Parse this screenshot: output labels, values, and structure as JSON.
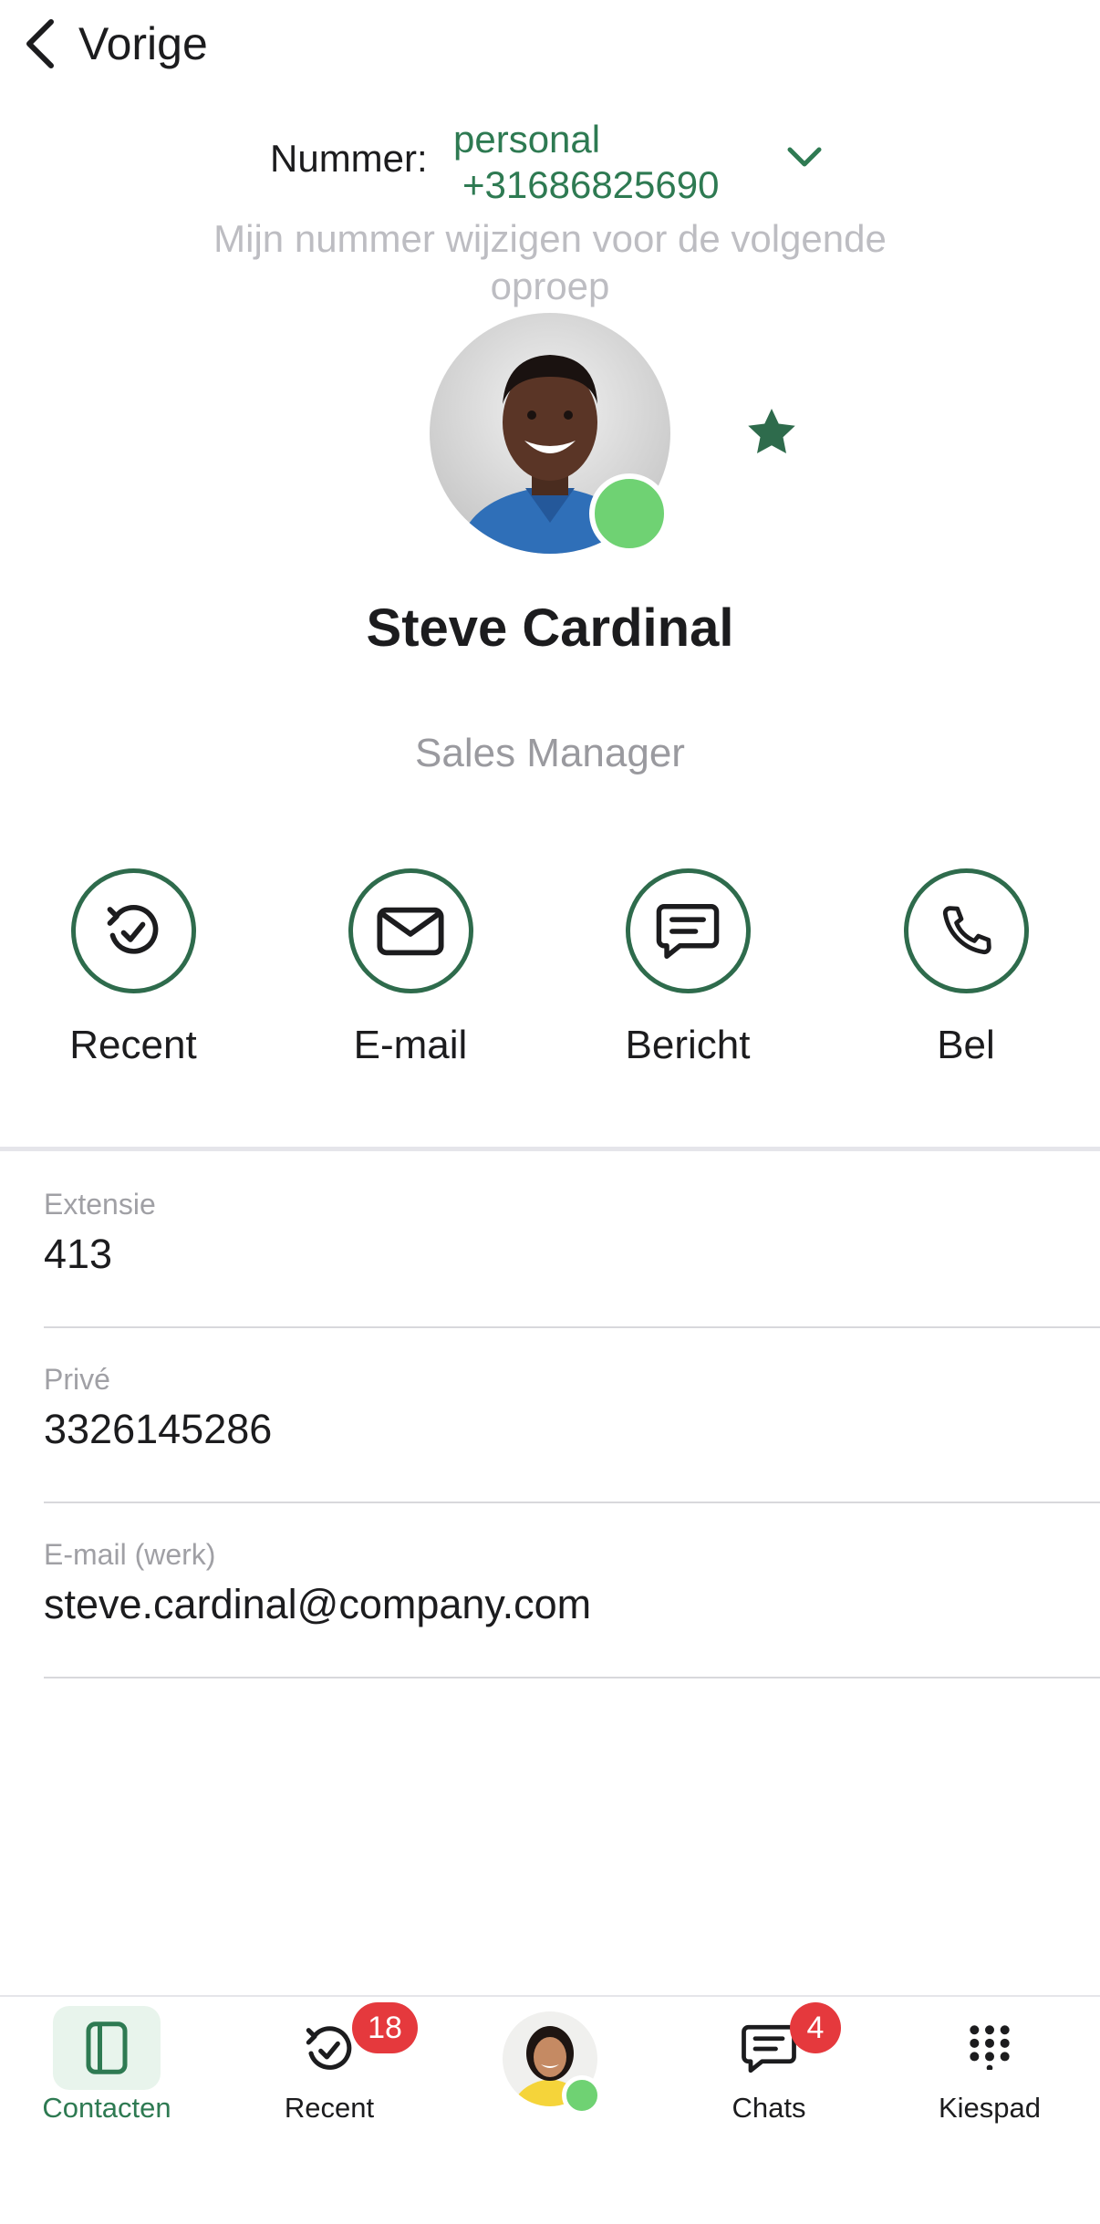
{
  "header": {
    "back_label": "Vorige",
    "back_icon": "chevron-left-icon"
  },
  "number_selector": {
    "label": "Nummer:",
    "type": "personal",
    "number": "+31686825690",
    "hint": "Mijn nummer wijzigen voor de volgende oproep"
  },
  "contact": {
    "name": "Steve Cardinal",
    "title": "Sales Manager",
    "status": "online",
    "favorite": true
  },
  "actions": [
    {
      "label": "Recent",
      "icon": "recent-icon"
    },
    {
      "label": "E-mail",
      "icon": "mail-icon"
    },
    {
      "label": "Bericht",
      "icon": "message-icon"
    },
    {
      "label": "Bel",
      "icon": "phone-icon"
    }
  ],
  "details": [
    {
      "key": "Extensie",
      "value": "413"
    },
    {
      "key": "Privé",
      "value": "3326145286"
    },
    {
      "key": "E-mail (werk)",
      "value": "steve.cardinal@company.com"
    }
  ],
  "tabs": [
    {
      "label": "Contacten",
      "active": true
    },
    {
      "label": "Recent",
      "badge": "18"
    },
    {
      "label": "",
      "is_avatar": true
    },
    {
      "label": "Chats",
      "badge": "4"
    },
    {
      "label": "Kiespad"
    }
  ],
  "colors": {
    "accent": "#2e7a52",
    "presence": "#6fd273",
    "badge": "#e5393d",
    "muted": "#9a9a9f"
  }
}
